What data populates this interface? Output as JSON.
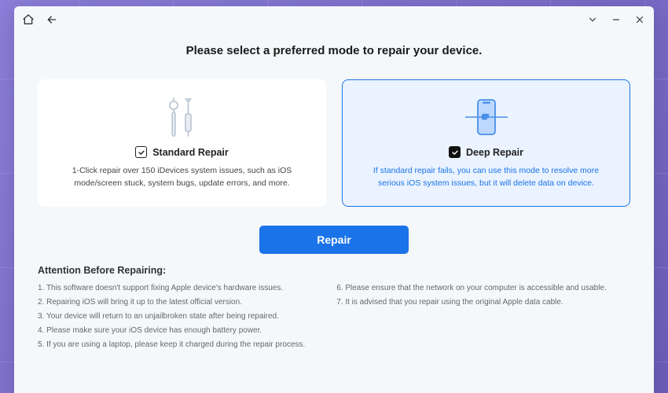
{
  "heading": "Please select a preferred mode to repair your device.",
  "cards": {
    "standard": {
      "title": "Standard Repair",
      "desc": "1-Click repair over 150 iDevices system issues, such as iOS mode/screen stuck, system bugs, update errors, and more."
    },
    "deep": {
      "title": "Deep Repair",
      "desc": "If standard repair fails, you can use this mode to resolve more serious iOS system issues, but it will delete data on device."
    }
  },
  "repair_button": "Repair",
  "attention": {
    "title": "Attention Before Repairing:",
    "left": [
      "1. This software doesn't support fixing Apple device's hardware issues.",
      "2. Repairing iOS will bring it up to the latest official version.",
      "3. Your device will return to an unjailbroken state after being repaired.",
      "4. Please make sure your iOS device has enough battery power.",
      "5. If you are using a laptop, please keep it charged during the repair process."
    ],
    "right": [
      "6. Please ensure that the network on your computer is accessible and usable.",
      "7. It is advised that you repair using the original Apple data cable."
    ]
  }
}
